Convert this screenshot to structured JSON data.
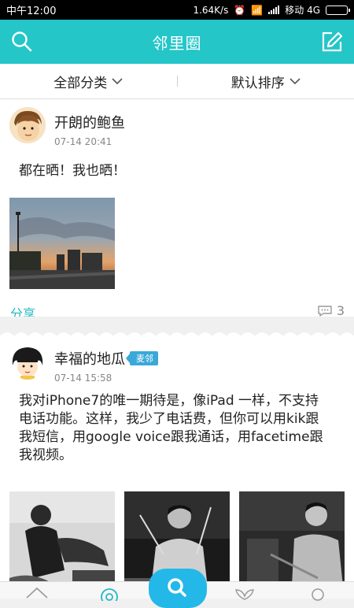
{
  "status": {
    "time": "中午12:00",
    "speed": "1.64K/s",
    "carrier": "移动 4G"
  },
  "header": {
    "title": "邻里圈",
    "search_icon": "search-icon",
    "edit_icon": "edit-icon"
  },
  "filters": {
    "category": "全部分类",
    "sort": "默认排序"
  },
  "posts": [
    {
      "author": "开朗的鲍鱼",
      "time": "07-14 20:41",
      "text": "都在晒！我也晒！",
      "share": "分享",
      "comment_count": "3"
    },
    {
      "author": "幸福的地瓜",
      "badge": "麦邻",
      "time": "07-14 15:58",
      "text": "我对iPhone7的唯一期待是，像iPad 一样，不支持电话功能。这样，我少了电话费，但你可以用kik跟我短信，用google voice跟我通话，用facetime跟我视频。"
    }
  ],
  "colors": {
    "accent": "#24c6c8",
    "share": "#1fb8c0",
    "badge": "#3aa8d8"
  }
}
